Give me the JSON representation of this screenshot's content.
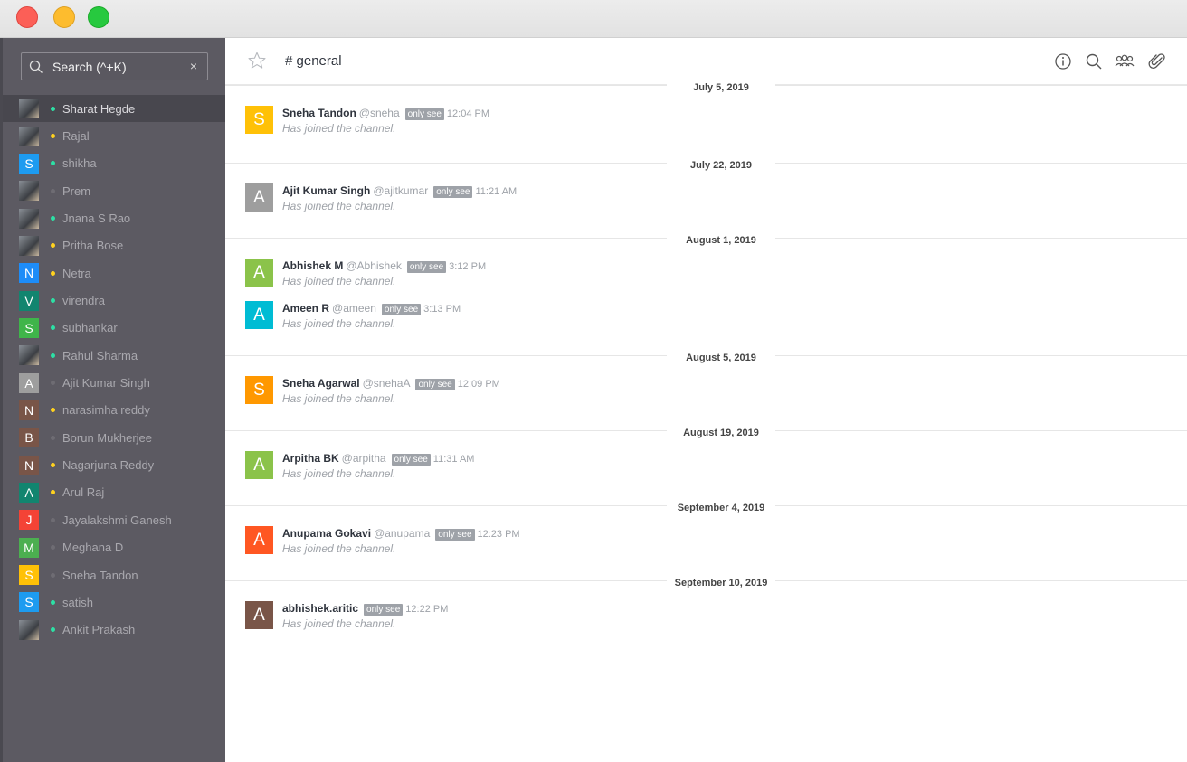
{
  "window": {
    "controls": {
      "close_color": "#fc5f57",
      "minimize_color": "#fdbc2e",
      "zoom_color": "#27c93f"
    }
  },
  "sidebar": {
    "search": {
      "placeholder": "Search (^+K)",
      "clear": "×",
      "icon": "search-icon"
    },
    "users": [
      {
        "name": "Sharat Hegde",
        "avatar": "photo",
        "status": "#2de0a5",
        "active": true
      },
      {
        "name": "Rajal",
        "avatar": "photo",
        "status": "#ffd21f"
      },
      {
        "name": "shikha",
        "avatar": "S",
        "color": "#1d9bf0",
        "status": "#2de0a5"
      },
      {
        "name": "Prem",
        "avatar": "photo",
        "status": "#6e6c73"
      },
      {
        "name": "Jnana S Rao",
        "avatar": "photo",
        "status": "#2de0a5"
      },
      {
        "name": "Pritha Bose",
        "avatar": "photo",
        "status": "#ffd21f"
      },
      {
        "name": "Netra",
        "avatar": "N",
        "color": "#1d8cf8",
        "status": "#ffd21f"
      },
      {
        "name": "virendra",
        "avatar": "V",
        "color": "#12856f",
        "status": "#2de0a5"
      },
      {
        "name": "subhankar",
        "avatar": "S",
        "color": "#3fb54a",
        "status": "#2de0a5"
      },
      {
        "name": "Rahul Sharma",
        "avatar": "photo",
        "status": "#2de0a5"
      },
      {
        "name": "Ajit Kumar Singh",
        "avatar": "A",
        "color": "#9e9e9e",
        "status": "#6e6c73"
      },
      {
        "name": "narasimha reddy",
        "avatar": "N",
        "color": "#795548",
        "status": "#ffd21f"
      },
      {
        "name": "Borun Mukherjee",
        "avatar": "B",
        "color": "#795548",
        "status": "#6e6c73"
      },
      {
        "name": "Nagarjuna Reddy",
        "avatar": "N",
        "color": "#795548",
        "status": "#ffd21f"
      },
      {
        "name": "Arul Raj",
        "avatar": "A",
        "color": "#12856f",
        "status": "#ffd21f"
      },
      {
        "name": "Jayalakshmi Ganesh",
        "avatar": "J",
        "color": "#f44336",
        "status": "#6e6c73"
      },
      {
        "name": "Meghana D",
        "avatar": "M",
        "color": "#4caf50",
        "status": "#6e6c73"
      },
      {
        "name": "Sneha Tandon",
        "avatar": "S",
        "color": "#ffc107",
        "status": "#6e6c73"
      },
      {
        "name": "satish",
        "avatar": "S",
        "color": "#1d9bf0",
        "status": "#2de0a5"
      },
      {
        "name": "Ankit Prakash",
        "avatar": "photo",
        "status": "#2de0a5"
      }
    ]
  },
  "header": {
    "star_icon": "star-icon",
    "channel": "# general",
    "icons": [
      "info-icon",
      "search-icon",
      "members-icon",
      "attachment-icon"
    ]
  },
  "feed": {
    "badge_label": "only see",
    "system_text": "Has joined the channel.",
    "days": [
      {
        "date": "July 5, 2019",
        "messages": [
          {
            "name": "Sneha Tandon",
            "handle": "@sneha",
            "time": "12:04 PM",
            "initial": "S",
            "color": "#ffc107"
          }
        ]
      },
      {
        "date": "July 22, 2019",
        "messages": [
          {
            "name": "Ajit Kumar Singh",
            "handle": "@ajitkumar",
            "time": "11:21 AM",
            "initial": "A",
            "color": "#9e9e9e"
          }
        ]
      },
      {
        "date": "August 1, 2019",
        "messages": [
          {
            "name": "Abhishek M",
            "handle": "@Abhishek",
            "time": "3:12 PM",
            "initial": "A",
            "color": "#8bc34a"
          },
          {
            "name": "Ameen R",
            "handle": "@ameen",
            "time": "3:13 PM",
            "initial": "A",
            "color": "#00bcd4"
          }
        ]
      },
      {
        "date": "August 5, 2019",
        "messages": [
          {
            "name": "Sneha Agarwal",
            "handle": "@snehaA",
            "time": "12:09 PM",
            "initial": "S",
            "color": "#ff9800"
          }
        ]
      },
      {
        "date": "August 19, 2019",
        "messages": [
          {
            "name": "Arpitha BK",
            "handle": "@arpitha",
            "time": "11:31 AM",
            "initial": "A",
            "color": "#8bc34a"
          }
        ]
      },
      {
        "date": "September 4, 2019",
        "messages": [
          {
            "name": "Anupama Gokavi",
            "handle": "@anupama",
            "time": "12:23 PM",
            "initial": "A",
            "color": "#ff5722"
          }
        ]
      },
      {
        "date": "September 10, 2019",
        "messages": [
          {
            "name": "abhishek.aritic",
            "handle": "",
            "time": "12:22 PM",
            "initial": "A",
            "color": "#795548"
          }
        ]
      }
    ]
  }
}
